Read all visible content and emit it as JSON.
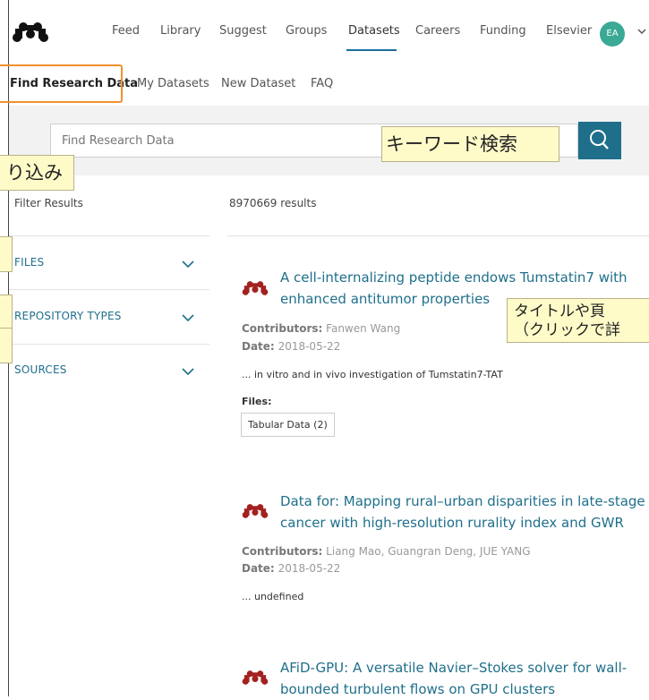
{
  "nav": {
    "items": [
      "Feed",
      "Library",
      "Suggest",
      "Groups",
      "Datasets",
      "Careers",
      "Funding",
      "Elsevier"
    ],
    "active": "Datasets",
    "avatar_initials": "EA"
  },
  "subnav": {
    "items": [
      "Find Research Data",
      "My Datasets",
      "New Dataset",
      "FAQ"
    ],
    "active": "Find Research Data"
  },
  "search": {
    "placeholder": "Find Research Data"
  },
  "annotations": {
    "keyword_search": "キーワード検索",
    "filter_narrow": "り込み",
    "title_line1": "タイトルや頁",
    "title_line2": "（クリックで詳"
  },
  "filters": {
    "title": "Filter Results",
    "facets": [
      "FILES",
      "REPOSITORY TYPES",
      "SOURCES"
    ]
  },
  "results": {
    "count": "8970669 results",
    "contributors_label": "Contributors:",
    "date_label": "Date:",
    "files_label": "Files:",
    "items": [
      {
        "title_line1": "A cell-internalizing peptide endows Tumstatin7 with",
        "title_line2": "enhanced antitumor properties",
        "contributors": "Fanwen Wang",
        "date": "2018-05-22",
        "snippet": "... in vitro and in vivo investigation of Tumstatin7-TAT",
        "file_chip": "Tabular Data (2)"
      },
      {
        "title_line1": "Data for: Mapping rural–urban disparities in late-stage",
        "title_line2": "cancer with high-resolution rurality index and GWR",
        "contributors": "Liang Mao, Guangran Deng, JUE YANG",
        "date": "2018-05-22",
        "snippet": "... undefined"
      },
      {
        "title_line1": "AFiD-GPU: A versatile Navier–Stokes solver for wall-",
        "title_line2": "bounded turbulent flows on GPU clusters"
      }
    ]
  },
  "colors": {
    "accent": "#1f6f8b",
    "highlight_border": "#f0902d",
    "callout_bg": "#fffbc9",
    "avatar_bg": "#3aa996",
    "logo_red": "#a3211f"
  }
}
